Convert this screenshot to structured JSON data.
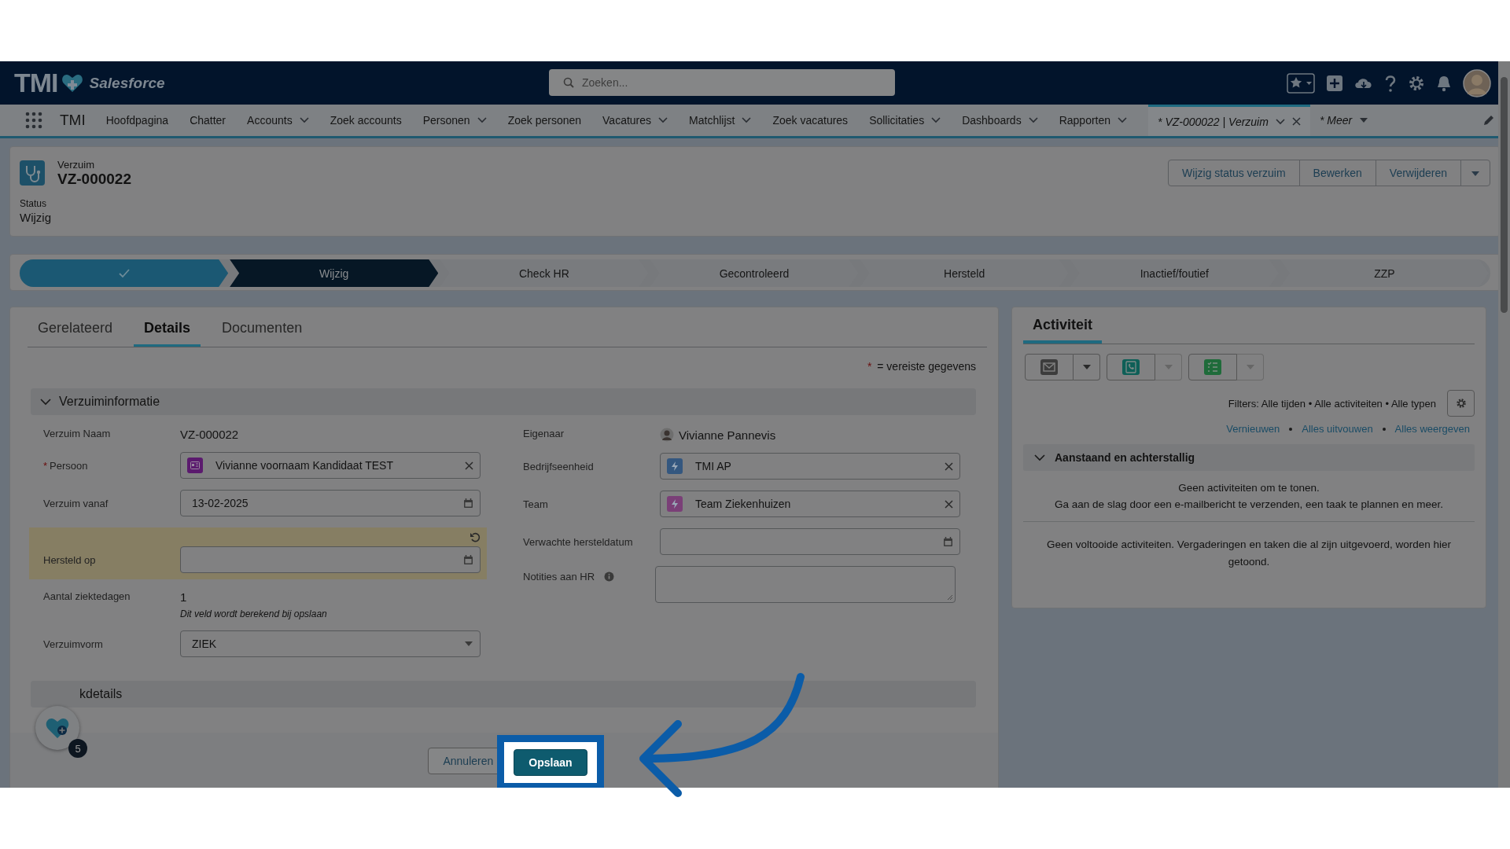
{
  "header": {
    "logo": "TMI",
    "brand": "Salesforce",
    "search": {
      "placeholder": "Zoeken..."
    }
  },
  "nav": {
    "app_name": "TMI",
    "items": [
      {
        "label": "Hoofdpagina",
        "dropdown": false
      },
      {
        "label": "Chatter",
        "dropdown": false
      },
      {
        "label": "Accounts",
        "dropdown": true
      },
      {
        "label": "Zoek accounts",
        "dropdown": false
      },
      {
        "label": "Personen",
        "dropdown": true
      },
      {
        "label": "Zoek personen",
        "dropdown": false
      },
      {
        "label": "Vacatures",
        "dropdown": true
      },
      {
        "label": "Matchlijst",
        "dropdown": true
      },
      {
        "label": "Zoek vacatures",
        "dropdown": false
      },
      {
        "label": "Sollicitaties",
        "dropdown": true
      },
      {
        "label": "Dashboards",
        "dropdown": true
      },
      {
        "label": "Rapporten",
        "dropdown": true
      }
    ],
    "open_tabs": [
      {
        "label": "* VZ-000022 | Verzuim",
        "selected": true,
        "closable": true
      },
      {
        "label": "* Meer",
        "selected": false,
        "closable": false
      }
    ]
  },
  "record": {
    "object": "Verzuim",
    "name": "VZ-000022",
    "actions": [
      "Wijzig status verzuim",
      "Bewerken",
      "Verwijderen"
    ],
    "status_label": "Status",
    "status_value": "Wijzig"
  },
  "path": [
    {
      "complete": true,
      "selected": false
    },
    {
      "label": "Wijzig",
      "complete": false,
      "selected": true
    },
    {
      "label": "Check HR",
      "complete": false,
      "selected": false
    },
    {
      "label": "Gecontroleerd",
      "complete": false,
      "selected": false
    },
    {
      "label": "Hersteld",
      "complete": false,
      "selected": false
    },
    {
      "label": "Inactief/foutief",
      "complete": false,
      "selected": false
    },
    {
      "label": "ZZP",
      "complete": false,
      "selected": false
    }
  ],
  "tabs": [
    {
      "label": "Gerelateerd",
      "selected": false
    },
    {
      "label": "Details",
      "selected": true
    },
    {
      "label": "Documenten",
      "selected": false
    }
  ],
  "required_note": {
    "mark": "*",
    "text": "= vereiste gegevens"
  },
  "section": {
    "title": "Verzuiminformatie",
    "expanded": true
  },
  "left_fields": [
    {
      "kind": "text",
      "label": "Verzuim Naam",
      "value": "VZ-000022"
    },
    {
      "kind": "lookup",
      "label": "Persoon",
      "required": true,
      "value": "Vivianne voornaam Kandidaat TEST",
      "color": "#5b1a6e"
    },
    {
      "kind": "date",
      "label": "Verzuim vanaf",
      "value": "13-02-2025"
    },
    {
      "kind": "date",
      "label": "Hersteld op",
      "changed": true
    },
    {
      "kind": "text",
      "label": "Aantal ziektedagen",
      "value": "1",
      "note": "Dit veld wordt berekend bij opslaan"
    },
    {
      "kind": "select",
      "label": "Verzuimvorm",
      "value": "ZIEK"
    }
  ],
  "right_fields": [
    {
      "kind": "owner",
      "label": "Eigenaar",
      "value": "Vivianne Pannevis"
    },
    {
      "kind": "lookup",
      "label": "Bedrijfseenheid",
      "value": "TMI AP",
      "color": "#34577f"
    },
    {
      "kind": "lookup",
      "label": "Team",
      "value": "Team Ziekenhuizen",
      "color": "#7a3f77"
    },
    {
      "kind": "date",
      "label": "Verwachte hersteldatum"
    },
    {
      "kind": "textarea",
      "label": "Notities aan HR",
      "info": true
    }
  ],
  "section2": {
    "title": "kdetails"
  },
  "activity": {
    "title": "Activiteit",
    "filters": "Filters: Alle tijden • Alle activiteiten • Alle typen",
    "links": [
      "Vernieuwen",
      "Alles uitvouwen",
      "Alles weergeven"
    ],
    "group": {
      "title": "Aanstaand en achterstallig",
      "expanded": true
    },
    "empty": [
      "Geen activiteiten om te tonen.",
      "Ga aan de slag door een e-mailbericht te verzenden, een taak te plannen en meer."
    ],
    "done": "Geen voltooide activiteiten. Vergaderingen en taken die al zijn uitgevoerd, worden hier getoond."
  },
  "footer": {
    "buttons": [
      {
        "label": "Annuleren",
        "kind": "neutral"
      },
      {
        "label": "Opslaan",
        "kind": "brand"
      }
    ]
  },
  "helper": {
    "badge": "5"
  }
}
